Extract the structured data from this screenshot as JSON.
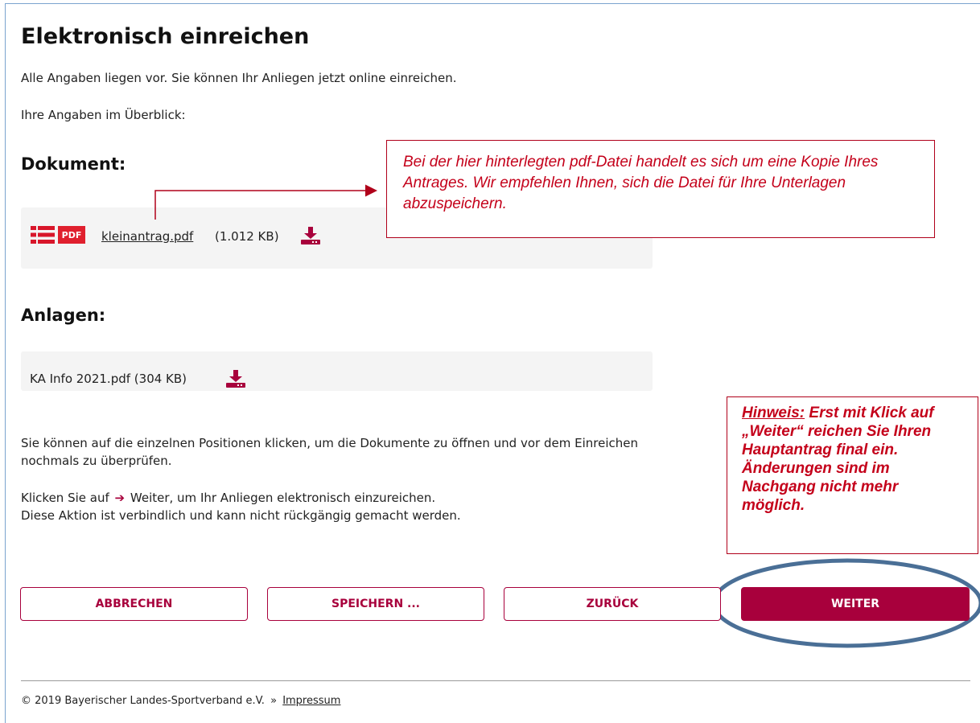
{
  "page": {
    "title": "Elektronisch einreichen",
    "intro": "Alle Angaben liegen vor. Sie können Ihr Anliegen jetzt online einreichen.",
    "overview_label": "Ihre Angaben im Überblick:"
  },
  "dokument": {
    "heading": "Dokument:",
    "pdf_badge": "PDF",
    "file_name": "kleinantrag.pdf",
    "file_size": "(1.012 KB)"
  },
  "anlagen": {
    "heading": "Anlagen:",
    "file": "KA Info 2021.pdf (304 KB)"
  },
  "info": {
    "text": "Sie können auf die einzelnen Positionen klicken, um die Dokumente zu öffnen und vor dem Einreichen nochmals zu überprüfen.",
    "action_prefix": "Klicken Sie auf",
    "action_suffix": "Weiter, um Ihr Anliegen elektronisch einzureichen.",
    "action_line2": "Diese Aktion ist verbindlich und kann nicht rückgängig gemacht werden."
  },
  "buttons": {
    "cancel": "ABBRECHEN",
    "save": "SPEICHERN ...",
    "back": "ZURÜCK",
    "next": "WEITER"
  },
  "footer": {
    "copyright": "© 2019 Bayerischer Landes-Sportverband e.V.",
    "chevron": "»",
    "impressum": "Impressum"
  },
  "callouts": {
    "pdf_note": "Bei der hier hinterlegten pdf-Datei handelt es sich um eine Kopie Ihres Antrages. Wir empfehlen Ihnen, sich die Datei für Ihre Unterlagen abzuspeichern.",
    "hinweis_label": "Hinweis:",
    "hinweis_text": "Erst mit Klick auf „Weiter“ reichen Sie Ihren Hauptantrag final ein. Änderungen sind im Nachgang nicht mehr möglich."
  },
  "icons": {
    "list": "list-icon",
    "download": "download-icon",
    "arrow": "arrow-right-icon"
  },
  "colors": {
    "accent": "#a8003c",
    "annotation": "#c4001a",
    "highlight_ellipse": "#4a6f96",
    "pdf_badge": "#e0202e"
  }
}
